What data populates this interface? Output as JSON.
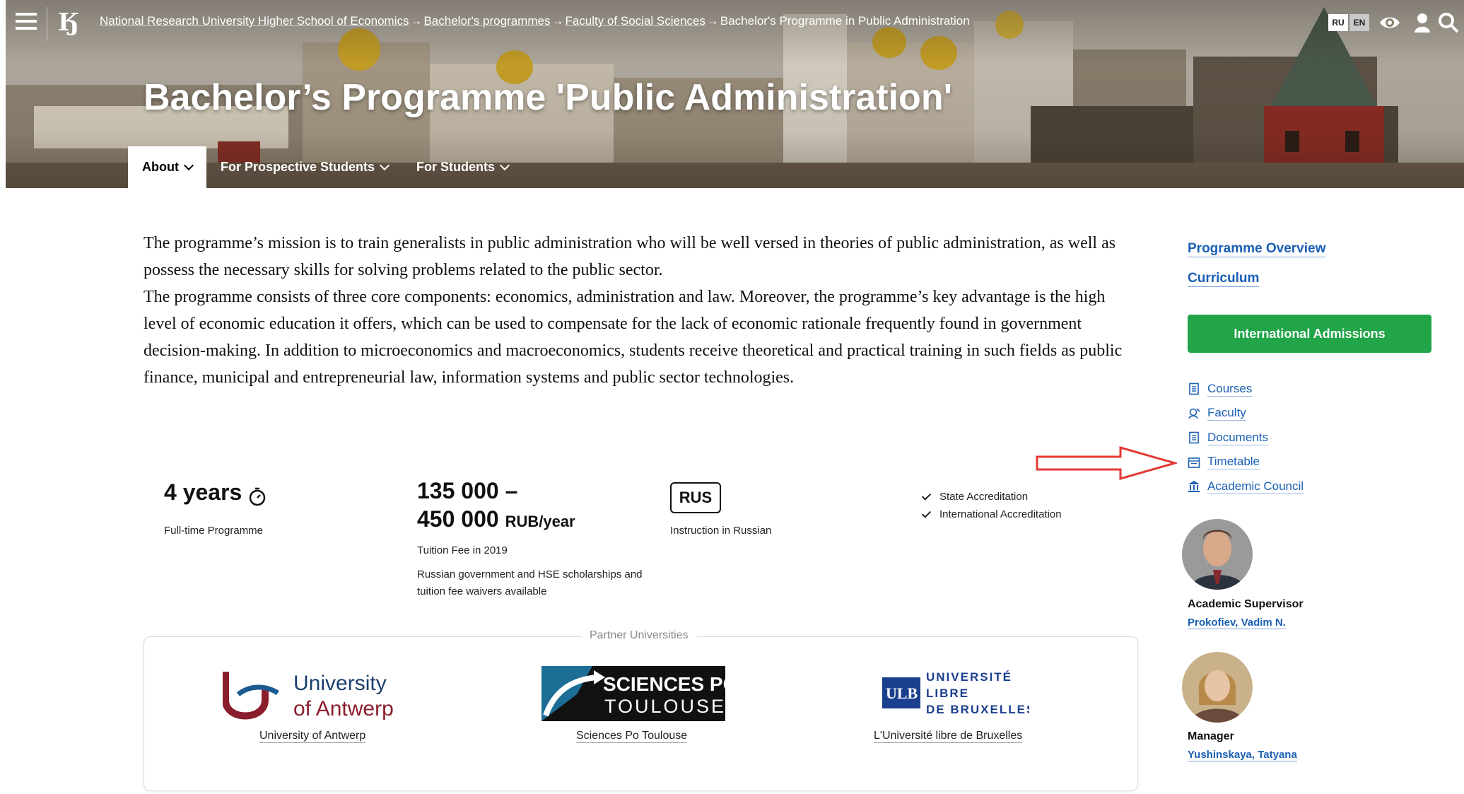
{
  "header": {
    "breadcrumb": {
      "item1": "National Research University Higher School of Economics",
      "item2": "Bachelor's programmes",
      "item3": "Faculty of Social Sciences",
      "item4": "Bachelor's Programme in Public Administration",
      "separator": "→"
    },
    "lang_ru": "RU",
    "lang_en": "EN",
    "title": "Bachelor’s Programme 'Public Administration'",
    "tabs": [
      {
        "label": "About"
      },
      {
        "label": "For Prospective Students"
      },
      {
        "label": "For Students"
      }
    ]
  },
  "description": {
    "paragraph1": "The programme’s mission is to train generalists in public administration who will be well versed in theories of public administration, as well as possess the necessary skills for solving problems related to the public sector.",
    "paragraph2": "The programme consists of three core components: economics, administration and law. Moreover, the programme’s key advantage is the high level of economic education it offers, which can be used to compensate for the lack of economic rationale frequently found in government decision-making. In addition to microeconomics and macroeconomics, students receive theoretical and practical training in such fields as public finance, municipal and entrepreneurial law, information systems and public sector technologies."
  },
  "stats": {
    "duration": "4 years",
    "duration_label": "Full-time Programme",
    "fee_line1": "135 000 –",
    "fee_line2": "450 000",
    "fee_unit": "RUB/year",
    "fee_label": "Tuition Fee in 2019",
    "fee_note": "Russian government and HSE scholarships and tuition fee waivers available",
    "language_badge": "RUS",
    "language_label": "Instruction in Russian",
    "accreditations": [
      "State Accreditation",
      "International Accreditation"
    ]
  },
  "sidebar": {
    "overview": "Programme Overview",
    "curriculum": "Curriculum",
    "admissions_button": "International Admissions",
    "resources": [
      {
        "label": "Courses",
        "icon": "document-icon"
      },
      {
        "label": "Faculty",
        "icon": "faculty-icon"
      },
      {
        "label": "Documents",
        "icon": "document-icon"
      },
      {
        "label": "Timetable",
        "icon": "calendar-icon"
      },
      {
        "label": "Academic Council",
        "icon": "building-icon"
      }
    ],
    "supervisor_role": "Academic Supervisor",
    "supervisor_name": "Prokofiev, Vadim N.",
    "manager_role": "Manager",
    "manager_name": "Yushinskaya, Tatyana"
  },
  "partners": {
    "title": "Partner Universities",
    "items": [
      {
        "name": "University of Antwerp",
        "logo_line1": "University",
        "logo_line2": "of Antwerp"
      },
      {
        "name": "Sciences Po Toulouse",
        "logo_line1": "SCIENCES PO",
        "logo_line2": "TOULOUSE"
      },
      {
        "name": "L'Université libre de Bruxelles",
        "logo_abbr": "ULB",
        "logo_line1": "UNIVERSITÉ",
        "logo_line2": "LIBRE",
        "logo_line3": "DE BRUXELLES"
      }
    ]
  },
  "colors": {
    "accent_green": "#21a548",
    "link_blue": "#1a5fb4",
    "arrow_red": "#e53935",
    "antwerp_red": "#8b1e2d",
    "ulb_blue": "#1b3f8f"
  }
}
